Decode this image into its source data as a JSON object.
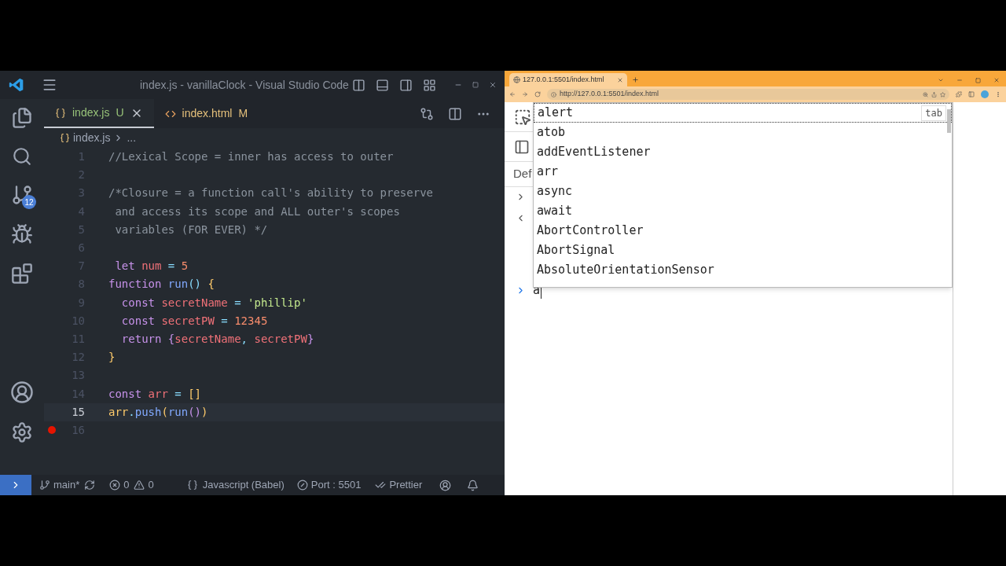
{
  "vscode": {
    "title": "index.js - vanillaClock - Visual Studio Code",
    "activity_badge": "12",
    "tabs": [
      {
        "label": "index.js",
        "status": "U",
        "kind": "js",
        "selected": true
      },
      {
        "label": "index.html",
        "status": "M",
        "kind": "html",
        "selected": false
      }
    ],
    "breadcrumb": {
      "file": "index.js",
      "rest": "..."
    },
    "lines": [
      {
        "n": "1",
        "current": false,
        "breakpoint": false,
        "tokens": [
          {
            "t": "//Lexical Scope = inner has access to outer",
            "kind": "comment"
          }
        ]
      },
      {
        "n": "2",
        "current": false,
        "breakpoint": false
      },
      {
        "n": "3",
        "current": false,
        "breakpoint": false,
        "tokens": [
          {
            "t": "/*Closure = a function call's ability to preserve",
            "kind": "comment"
          }
        ]
      },
      {
        "n": "4",
        "current": false,
        "breakpoint": false,
        "tokens": [
          {
            "t": " and access its scope and ALL outer's scopes",
            "kind": "comment"
          }
        ]
      },
      {
        "n": "5",
        "current": false,
        "breakpoint": false,
        "tokens": [
          {
            "t": " variables (FOR EVER) */",
            "kind": "comment"
          }
        ]
      },
      {
        "n": "6",
        "current": false,
        "breakpoint": false
      },
      {
        "n": "7",
        "current": false,
        "breakpoint": false,
        "tokens": [
          {
            "t": " let",
            "kind": "keyword"
          },
          {
            "t": " num",
            "kind": "variable"
          },
          {
            "t": " =",
            "kind": "operator"
          },
          {
            "t": " 5",
            "kind": "number"
          }
        ]
      },
      {
        "n": "8",
        "current": false,
        "breakpoint": false,
        "tokens": [
          {
            "t": "function",
            "kind": "keyword"
          },
          {
            "t": " run",
            "kind": "function"
          },
          {
            "t": "()",
            "kind": "punct"
          },
          {
            "t": " {",
            "kind": "brace"
          }
        ]
      },
      {
        "n": "9",
        "current": false,
        "breakpoint": false,
        "tokens": [
          {
            "t": "  const",
            "kind": "keyword"
          },
          {
            "t": " secretName",
            "kind": "variable"
          },
          {
            "t": " =",
            "kind": "operator"
          },
          {
            "t": " 'phillip'",
            "kind": "string"
          }
        ]
      },
      {
        "n": "10",
        "current": false,
        "breakpoint": false,
        "tokens": [
          {
            "t": "  const",
            "kind": "keyword"
          },
          {
            "t": " secretPW",
            "kind": "variable"
          },
          {
            "t": " =",
            "kind": "operator"
          },
          {
            "t": " 12345",
            "kind": "number"
          }
        ]
      },
      {
        "n": "11",
        "current": false,
        "breakpoint": false,
        "tokens": [
          {
            "t": "  return",
            "kind": "keyword"
          },
          {
            "t": " {",
            "kind": "brace2"
          },
          {
            "t": "secretName",
            "kind": "variable"
          },
          {
            "t": ",",
            "kind": "punct"
          },
          {
            "t": " secretPW",
            "kind": "variable"
          },
          {
            "t": "}",
            "kind": "brace2"
          }
        ]
      },
      {
        "n": "12",
        "current": false,
        "breakpoint": false,
        "tokens": [
          {
            "t": "}",
            "kind": "brace"
          }
        ]
      },
      {
        "n": "13",
        "current": false,
        "breakpoint": false
      },
      {
        "n": "14",
        "current": false,
        "breakpoint": false,
        "tokens": [
          {
            "t": "const",
            "kind": "keyword"
          },
          {
            "t": " arr",
            "kind": "variable"
          },
          {
            "t": " =",
            "kind": "operator"
          },
          {
            "t": " []",
            "kind": "brace"
          }
        ]
      },
      {
        "n": "15",
        "current": true,
        "breakpoint": false,
        "tokens": [
          {
            "t": "arr",
            "kind": "plain"
          },
          {
            "t": ".",
            "kind": "punct"
          },
          {
            "t": "push",
            "kind": "function"
          },
          {
            "t": "(",
            "kind": "brace"
          },
          {
            "t": "run",
            "kind": "function"
          },
          {
            "t": "()",
            "kind": "brace2"
          },
          {
            "t": ")",
            "kind": "brace"
          }
        ]
      },
      {
        "n": "16",
        "current": false,
        "breakpoint": true
      }
    ],
    "status_bar": {
      "branch": "main*",
      "errors": "0",
      "warnings": "0",
      "language": "Javascript (Babel)",
      "port": "Port : 5501",
      "formatter": "Prettier"
    }
  },
  "browser": {
    "tab_title": "127.0.0.1:5501/index.html",
    "url": "http://127.0.0.1:5501/index.html",
    "devtools": {
      "partial_label": "Def",
      "input": "a",
      "suggestions": [
        {
          "label": "alert",
          "selected": true,
          "hint": "tab"
        },
        {
          "label": "atob",
          "selected": false
        },
        {
          "label": "addEventListener",
          "selected": false
        },
        {
          "label": "arr",
          "selected": false
        },
        {
          "label": "async",
          "selected": false
        },
        {
          "label": "await",
          "selected": false
        },
        {
          "label": "AbortController",
          "selected": false
        },
        {
          "label": "AbortSignal",
          "selected": false
        },
        {
          "label": "AbsoluteOrientationSensor",
          "selected": false
        }
      ]
    }
  }
}
